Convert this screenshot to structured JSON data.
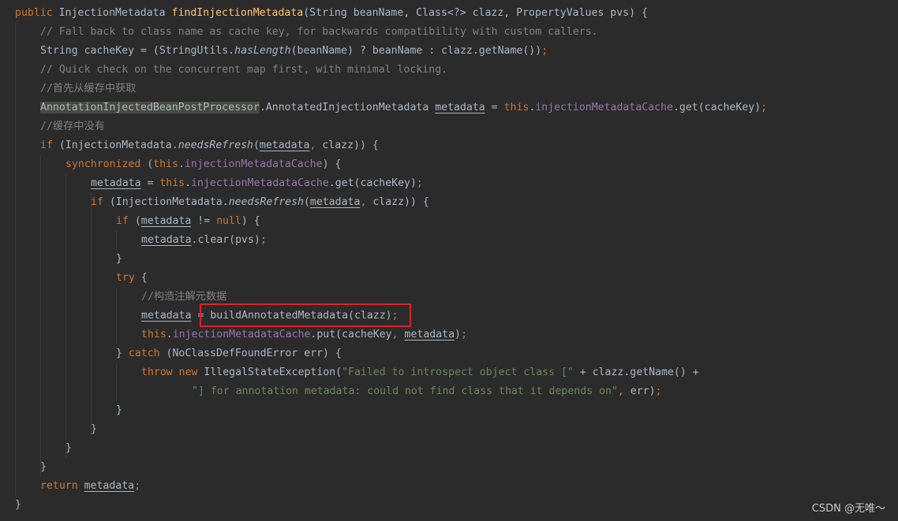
{
  "colors": {
    "background": "#2b2b2b",
    "default_text": "#a9b7c6",
    "keyword": "#cc7832",
    "method_declaration": "#ffc66d",
    "comment": "#808080",
    "string": "#6a8759",
    "field": "#9876aa",
    "highlight_box": "#e0202a"
  },
  "code_lines": [
    {
      "indent": 0,
      "tokens": [
        {
          "t": "public ",
          "c": "kw"
        },
        {
          "t": "InjectionMetadata "
        },
        {
          "t": "findInjectionMetadata",
          "c": "fn"
        },
        {
          "t": "(String beanName, Class<?> clazz, PropertyValues pvs) {"
        }
      ]
    },
    {
      "indent": 1,
      "tokens": [
        {
          "t": "// Fall back to class name as cache key, for backwards compatibility with custom callers.",
          "c": "cm"
        }
      ]
    },
    {
      "indent": 1,
      "tokens": [
        {
          "t": "String cacheKey = (StringUtils."
        },
        {
          "t": "hasLength",
          "c": "it"
        },
        {
          "t": "(beanName) ? beanName : clazz.getName())"
        },
        {
          "t": ";",
          "c": "kw"
        }
      ]
    },
    {
      "indent": 1,
      "tokens": [
        {
          "t": "// Quick check on the concurrent map first, with minimal locking.",
          "c": "cm"
        }
      ]
    },
    {
      "indent": 1,
      "tokens": [
        {
          "t": "//首先从缓存中获取",
          "c": "cm"
        }
      ]
    },
    {
      "indent": 1,
      "tokens": [
        {
          "t": "AnnotationInjectedBeanPostProcessor",
          "c": "hl"
        },
        {
          "t": ".AnnotatedInjectionMetadata "
        },
        {
          "t": "metadata",
          "c": "ul"
        },
        {
          "t": " = "
        },
        {
          "t": "this",
          "c": "kw"
        },
        {
          "t": "."
        },
        {
          "t": "injectionMetadataCache",
          "c": "fd"
        },
        {
          "t": ".get(cacheKey)"
        },
        {
          "t": ";",
          "c": "kw"
        }
      ]
    },
    {
      "indent": 1,
      "tokens": [
        {
          "t": "//缓存中没有",
          "c": "cm"
        }
      ]
    },
    {
      "indent": 1,
      "tokens": [
        {
          "t": "if ",
          "c": "kw"
        },
        {
          "t": "(InjectionMetadata."
        },
        {
          "t": "needsRefresh",
          "c": "it"
        },
        {
          "t": "("
        },
        {
          "t": "metadata",
          "c": "ul"
        },
        {
          "t": ", ",
          "c": "kw"
        },
        {
          "t": "clazz)) {"
        }
      ]
    },
    {
      "indent": 2,
      "tokens": [
        {
          "t": "synchronized ",
          "c": "kw"
        },
        {
          "t": "("
        },
        {
          "t": "this",
          "c": "kw"
        },
        {
          "t": "."
        },
        {
          "t": "injectionMetadataCache",
          "c": "fd"
        },
        {
          "t": ") {"
        }
      ]
    },
    {
      "indent": 3,
      "tokens": [
        {
          "t": "metadata",
          "c": "ul"
        },
        {
          "t": " = "
        },
        {
          "t": "this",
          "c": "kw"
        },
        {
          "t": "."
        },
        {
          "t": "injectionMetadataCache",
          "c": "fd"
        },
        {
          "t": ".get(cacheKey)"
        },
        {
          "t": ";",
          "c": "kw"
        }
      ]
    },
    {
      "indent": 3,
      "tokens": [
        {
          "t": "if ",
          "c": "kw"
        },
        {
          "t": "(InjectionMetadata."
        },
        {
          "t": "needsRefresh",
          "c": "it"
        },
        {
          "t": "("
        },
        {
          "t": "metadata",
          "c": "ul"
        },
        {
          "t": ", ",
          "c": "kw"
        },
        {
          "t": "clazz)) {"
        }
      ]
    },
    {
      "indent": 4,
      "tokens": [
        {
          "t": "if ",
          "c": "kw"
        },
        {
          "t": "("
        },
        {
          "t": "metadata",
          "c": "ul"
        },
        {
          "t": " != "
        },
        {
          "t": "null",
          "c": "kw"
        },
        {
          "t": ") {"
        }
      ]
    },
    {
      "indent": 5,
      "tokens": [
        {
          "t": "metadata",
          "c": "ul"
        },
        {
          "t": ".clear(pvs)"
        },
        {
          "t": ";",
          "c": "kw"
        }
      ]
    },
    {
      "indent": 4,
      "tokens": [
        {
          "t": "}"
        }
      ]
    },
    {
      "indent": 4,
      "tokens": [
        {
          "t": "try ",
          "c": "kw"
        },
        {
          "t": "{"
        }
      ]
    },
    {
      "indent": 5,
      "tokens": [
        {
          "t": "//构造注解元数据",
          "c": "cm"
        }
      ]
    },
    {
      "indent": 5,
      "tokens": [
        {
          "t": "metadata",
          "c": "ul"
        },
        {
          "t": " = buildAnnotatedMetadata(clazz)"
        },
        {
          "t": ";",
          "c": "kw"
        }
      ]
    },
    {
      "indent": 5,
      "tokens": [
        {
          "t": "this",
          "c": "kw"
        },
        {
          "t": "."
        },
        {
          "t": "injectionMetadataCache",
          "c": "fd"
        },
        {
          "t": ".put(cacheKey"
        },
        {
          "t": ", ",
          "c": "kw"
        },
        {
          "t": "metadata",
          "c": "ul"
        },
        {
          "t": ")"
        },
        {
          "t": ";",
          "c": "kw"
        }
      ]
    },
    {
      "indent": 4,
      "tokens": [
        {
          "t": "} "
        },
        {
          "t": "catch ",
          "c": "kw"
        },
        {
          "t": "(NoClassDefFoundError err) {"
        }
      ]
    },
    {
      "indent": 5,
      "tokens": [
        {
          "t": "throw new ",
          "c": "kw"
        },
        {
          "t": "IllegalStateException("
        },
        {
          "t": "\"Failed to introspect object class [\"",
          "c": "st"
        },
        {
          "t": " + clazz.getName() +"
        }
      ]
    },
    {
      "indent": 7,
      "tokens": [
        {
          "t": "\"] for annotation metadata: could not find class that it depends on\"",
          "c": "st"
        },
        {
          "t": ", ",
          "c": "kw"
        },
        {
          "t": "err)"
        },
        {
          "t": ";",
          "c": "kw"
        }
      ]
    },
    {
      "indent": 4,
      "tokens": [
        {
          "t": "}"
        }
      ]
    },
    {
      "indent": 3,
      "tokens": [
        {
          "t": "}"
        }
      ]
    },
    {
      "indent": 2,
      "tokens": [
        {
          "t": "}"
        }
      ]
    },
    {
      "indent": 1,
      "tokens": [
        {
          "t": "}"
        }
      ]
    },
    {
      "indent": 1,
      "tokens": [
        {
          "t": "return ",
          "c": "kw"
        },
        {
          "t": "metadata",
          "c": "ul"
        },
        {
          "t": ";",
          "c": "kw"
        }
      ]
    },
    {
      "indent": 0,
      "tokens": [
        {
          "t": "}"
        }
      ]
    }
  ],
  "watermark": "CSDN @无唯～"
}
